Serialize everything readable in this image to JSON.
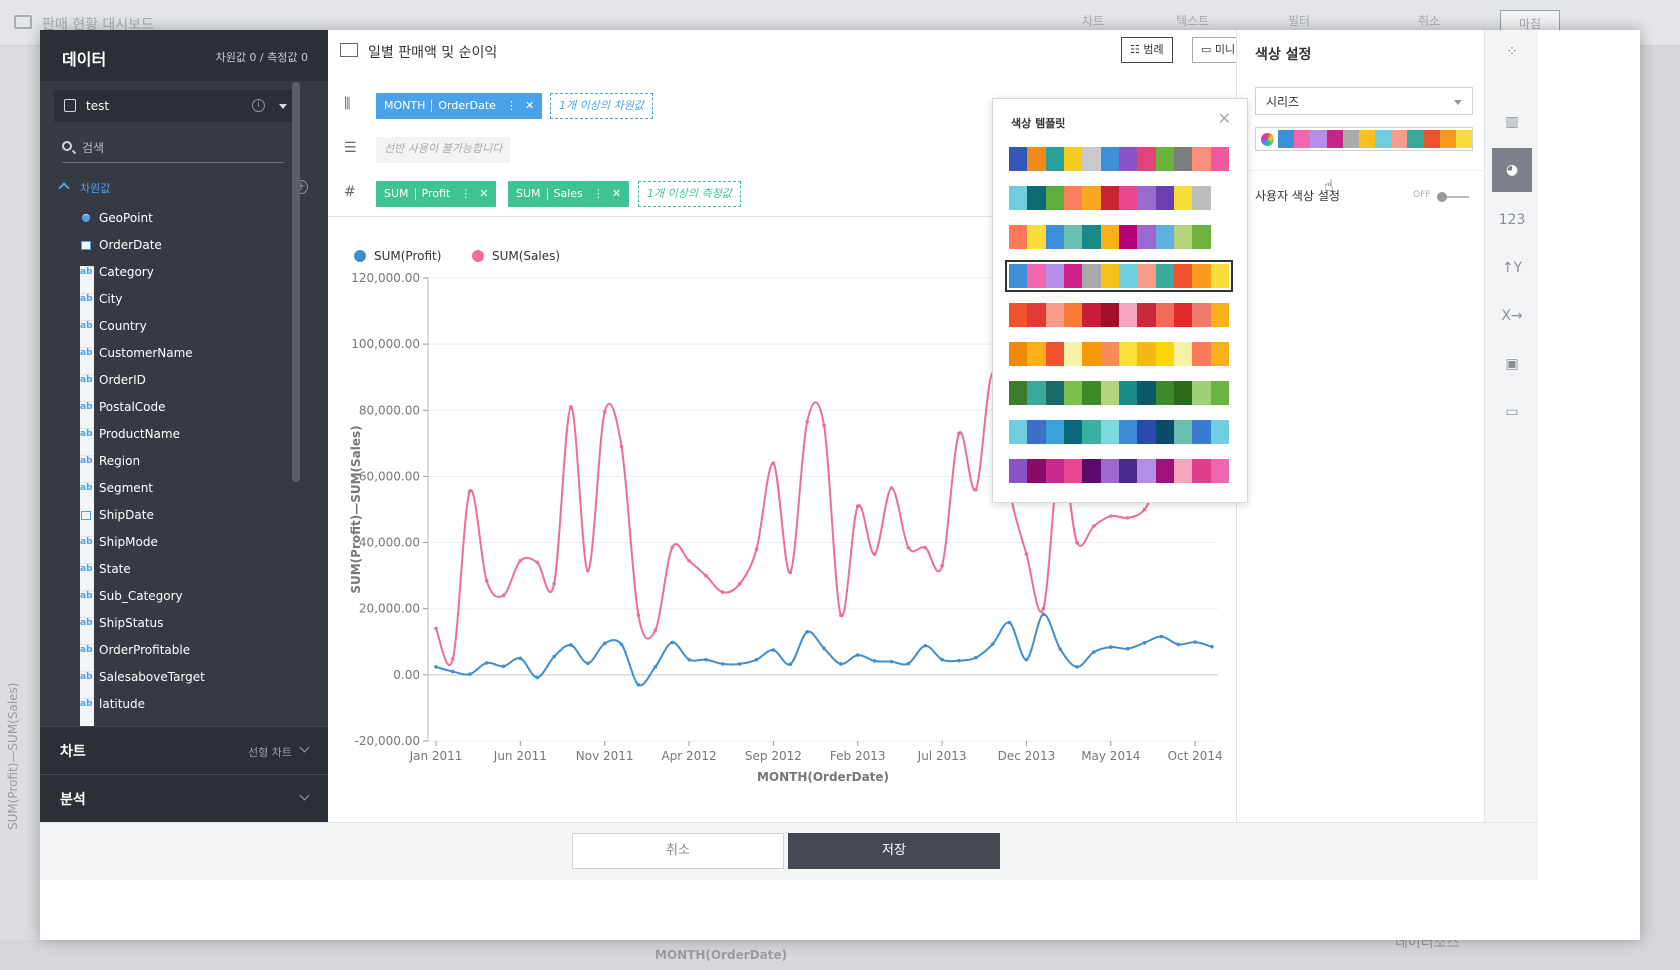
{
  "background": {
    "title": "판매 현황 대시보드",
    "tools": [
      "차트",
      "텍스트",
      "필터",
      "취소",
      "마침"
    ],
    "bottom_label": "MONTH(OrderDate)",
    "bottom_right": "데이터소스",
    "vertical_label": "SUM(Profit)—SUM(Sales)"
  },
  "data_panel": {
    "title": "데이터",
    "counts": "차원값 0 / 측정값 0",
    "datasource": "test",
    "search_placeholder": "검색",
    "dimension_header": "차원값",
    "fields": [
      {
        "type": "geo",
        "name": "GeoPoint"
      },
      {
        "type": "date",
        "name": "OrderDate"
      },
      {
        "type": "ab",
        "name": "Category"
      },
      {
        "type": "ab",
        "name": "City"
      },
      {
        "type": "ab",
        "name": "Country"
      },
      {
        "type": "ab",
        "name": "CustomerName"
      },
      {
        "type": "ab",
        "name": "OrderID"
      },
      {
        "type": "ab",
        "name": "PostalCode"
      },
      {
        "type": "ab",
        "name": "ProductName"
      },
      {
        "type": "ab",
        "name": "Region"
      },
      {
        "type": "ab",
        "name": "Segment"
      },
      {
        "type": "date",
        "name": "ShipDate"
      },
      {
        "type": "ab",
        "name": "ShipMode"
      },
      {
        "type": "ab",
        "name": "State"
      },
      {
        "type": "ab",
        "name": "Sub_Category"
      },
      {
        "type": "ab",
        "name": "ShipStatus"
      },
      {
        "type": "ab",
        "name": "OrderProfitable"
      },
      {
        "type": "ab",
        "name": "SalesaboveTarget"
      },
      {
        "type": "ab",
        "name": "latitude"
      }
    ],
    "chart_section": "차트",
    "chart_section_value": "선형 차트",
    "analysis_section": "분석"
  },
  "center": {
    "title": "일별 판매액 및 순이익",
    "legend_btn": "범례",
    "minimap_btn": "미니맵",
    "col_pill": {
      "agg": "MONTH",
      "field": "OrderDate"
    },
    "col_placeholder": "1개 이상의 차원값",
    "row_placeholder": "선반 사용이 불가능합니다",
    "measure_pills": [
      {
        "agg": "SUM",
        "field": "Profit"
      },
      {
        "agg": "SUM",
        "field": "Sales"
      }
    ],
    "measure_placeholder": "1개 이상의 측정값"
  },
  "chart_data": {
    "type": "line",
    "xlabel": "MONTH(OrderDate)",
    "ylabel": "SUM(Profit)—SUM(Sales)",
    "ylim": [
      -20000,
      120000
    ],
    "yticks": [
      "120,000.00",
      "100,000.00",
      "80,000.00",
      "60,000.00",
      "40,000.00",
      "20,000.00",
      "0.00",
      "-20,000.00"
    ],
    "xticks": [
      "Jan 2011",
      "Jun 2011",
      "Nov 2011",
      "Apr 2012",
      "Sep 2012",
      "Feb 2013",
      "Jul 2013",
      "Dec 2013",
      "May 2014",
      "Oct 2014"
    ],
    "series": [
      {
        "name": "SUM(Profit)",
        "color": "#3f8fce",
        "values": [
          2400,
          1000,
          200,
          3600,
          2600,
          5000,
          -800,
          5500,
          9000,
          3500,
          9500,
          9200,
          -3000,
          2400,
          9800,
          4600,
          4600,
          3300,
          3300,
          4600,
          7500,
          3200,
          13000,
          8000,
          3300,
          6000,
          4200,
          4000,
          3400,
          8800,
          4600,
          4300,
          5200,
          9300,
          15800,
          4600,
          18300,
          7800,
          2400,
          6900,
          8400,
          7900,
          9700,
          11600,
          9200,
          9900,
          8500
        ]
      },
      {
        "name": "SUM(Sales)",
        "color": "#ef6b9f",
        "values": [
          14000,
          4800,
          55500,
          28500,
          24000,
          34500,
          34000,
          27500,
          81000,
          31500,
          79500,
          69000,
          18000,
          13500,
          38500,
          34500,
          30000,
          25000,
          27500,
          38000,
          64000,
          31000,
          76500,
          75500,
          18000,
          51000,
          36500,
          56500,
          38500,
          38500,
          33000,
          73000,
          56000,
          91000,
          56000,
          36500,
          20000,
          67000,
          40000,
          45000,
          48000,
          47500,
          50000,
          60000,
          68000,
          73000,
          71000
        ]
      }
    ]
  },
  "palette_popup": {
    "title": "색상 템플릿",
    "selected_index": 3,
    "rows": [
      [
        "#3456b8",
        "#f08a1a",
        "#2aa09a",
        "#f2cd1c",
        "#c9c9c9",
        "#3d8fd8",
        "#8a54c8",
        "#e2437d",
        "#6cb33e",
        "#7d7d7d",
        "#fa8d7c",
        "#f0579d"
      ],
      [
        "#6fcde0",
        "#0f6b73",
        "#5fae3d",
        "#fa8060",
        "#f7a81e",
        "#cc2233",
        "#e94692",
        "#9a6ad0",
        "#6b3fb0",
        "#f7dd3a",
        "#bdbdbd",
        "#ffffff"
      ],
      [
        "#fa7a5a",
        "#f7dd3a",
        "#3d8fd8",
        "#6cc0b0",
        "#1b8a8a",
        "#fbb01a",
        "#b4007b",
        "#9a6ad0",
        "#5fb0e0",
        "#b3d47a",
        "#6db33f",
        "#ffffff"
      ],
      [
        "#3d8fd8",
        "#f067b0",
        "#b28ee6",
        "#cc2288",
        "#aaaaaa",
        "#f7c31a",
        "#6fcde0",
        "#f99b8a",
        "#3aa89a",
        "#f0522e",
        "#f99a1a",
        "#f7dd3a"
      ],
      [
        "#f0522e",
        "#e03a3a",
        "#f99b8a",
        "#fa7a3a",
        "#c81e3a",
        "#a0102a",
        "#f7a6c0",
        "#c82a3a",
        "#f36a5a",
        "#e32a2a",
        "#f07a6a",
        "#fbb01a"
      ],
      [
        "#f08a0a",
        "#fbb01a",
        "#f0522e",
        "#f7f0a8",
        "#f7990a",
        "#fa8a5a",
        "#fce03a",
        "#f7b81a",
        "#fbd40a",
        "#f7f0a8",
        "#fa7a5a",
        "#fbb01a"
      ],
      [
        "#3d7d2a",
        "#3aa89a",
        "#1a6a6a",
        "#7ac04a",
        "#3d8a2a",
        "#b3d47a",
        "#1a8a8a",
        "#0a5a6a",
        "#3d8a2a",
        "#2a6a1a",
        "#a0d07a",
        "#6db33f"
      ],
      [
        "#6fcde0",
        "#3d6fc8",
        "#3aa0d8",
        "#0a6a7a",
        "#3ab0a0",
        "#7adae0",
        "#3a8ad8",
        "#2a4ab0",
        "#0a4a6a",
        "#6ac0b0",
        "#3a7ad0",
        "#6fcde0"
      ],
      [
        "#8a54c8",
        "#8a0a6a",
        "#c82a8a",
        "#e94692",
        "#5a0a6a",
        "#9a6ad0",
        "#4a2a8a",
        "#b28ee6",
        "#a0107a",
        "#f7a6c0",
        "#e0408a",
        "#f067b0"
      ]
    ]
  },
  "color_panel": {
    "title": "색상 설정",
    "select_value": "시리즈",
    "bar_colors": [
      "#3d8fd8",
      "#f067b0",
      "#b28ee6",
      "#cc2288",
      "#aaaaaa",
      "#f7c31a",
      "#6fcde0",
      "#f99b8a",
      "#3aa89a",
      "#f0522e",
      "#f99a1a",
      "#f7dd3a"
    ],
    "user_color_label": "사용자 색상 설정",
    "toggle": "OFF"
  },
  "icon_strip": [
    "123"
  ],
  "footer": {
    "cancel": "취소",
    "save": "저장"
  }
}
